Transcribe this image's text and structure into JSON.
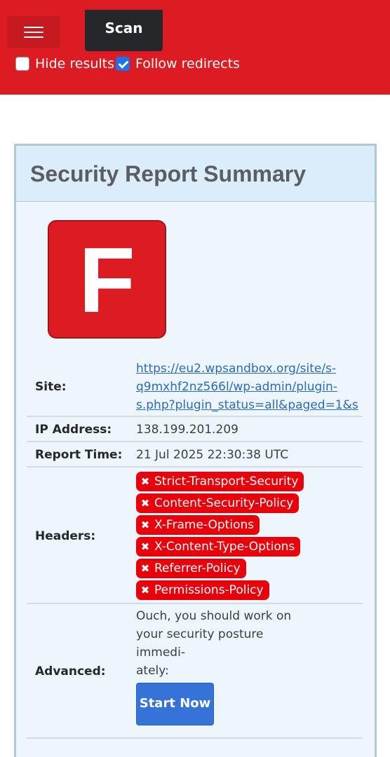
{
  "toolbar": {
    "menu_icon": "hamburger-menu-icon",
    "scan_label": "Scan",
    "hide_results_label": "Hide results",
    "hide_results_checked": false,
    "follow_redirects_label": "Follow redirects",
    "follow_redirects_checked": true
  },
  "report": {
    "title": "Security Report Summary",
    "grade": "F",
    "site_label": "Site:",
    "site_url_lines": [
      "https://eu2.wpsandbox.org/site/s-",
      "q9mxhf2nz566l/wp-admin/plugin-",
      "s.php?plugin_status=all&paged=1&s"
    ],
    "ip_label": "IP Address:",
    "ip_value": "138.199.201.209",
    "time_label": "Report Time:",
    "time_value": "21 Jul 2025 22:30:38 UTC",
    "headers_label": "Headers:",
    "headers": [
      "Strict-Transport-Security",
      "Content-Security-Policy",
      "X-Frame-Options",
      "X-Content-Type-Options",
      "Referrer-Policy",
      "Permissions-Policy"
    ],
    "header_status_icon": "x-mark-icon",
    "advanced_label": "Advanced:",
    "advanced_text_lines": [
      "Ouch, you should work on",
      "your security posture immedi-",
      "ately:"
    ],
    "start_button": "Start Now"
  },
  "colors": {
    "brand_red": "#dc1c22",
    "badge_red": "#e8000b",
    "button_blue": "#3573d9",
    "link_blue": "#2a6bbf"
  }
}
